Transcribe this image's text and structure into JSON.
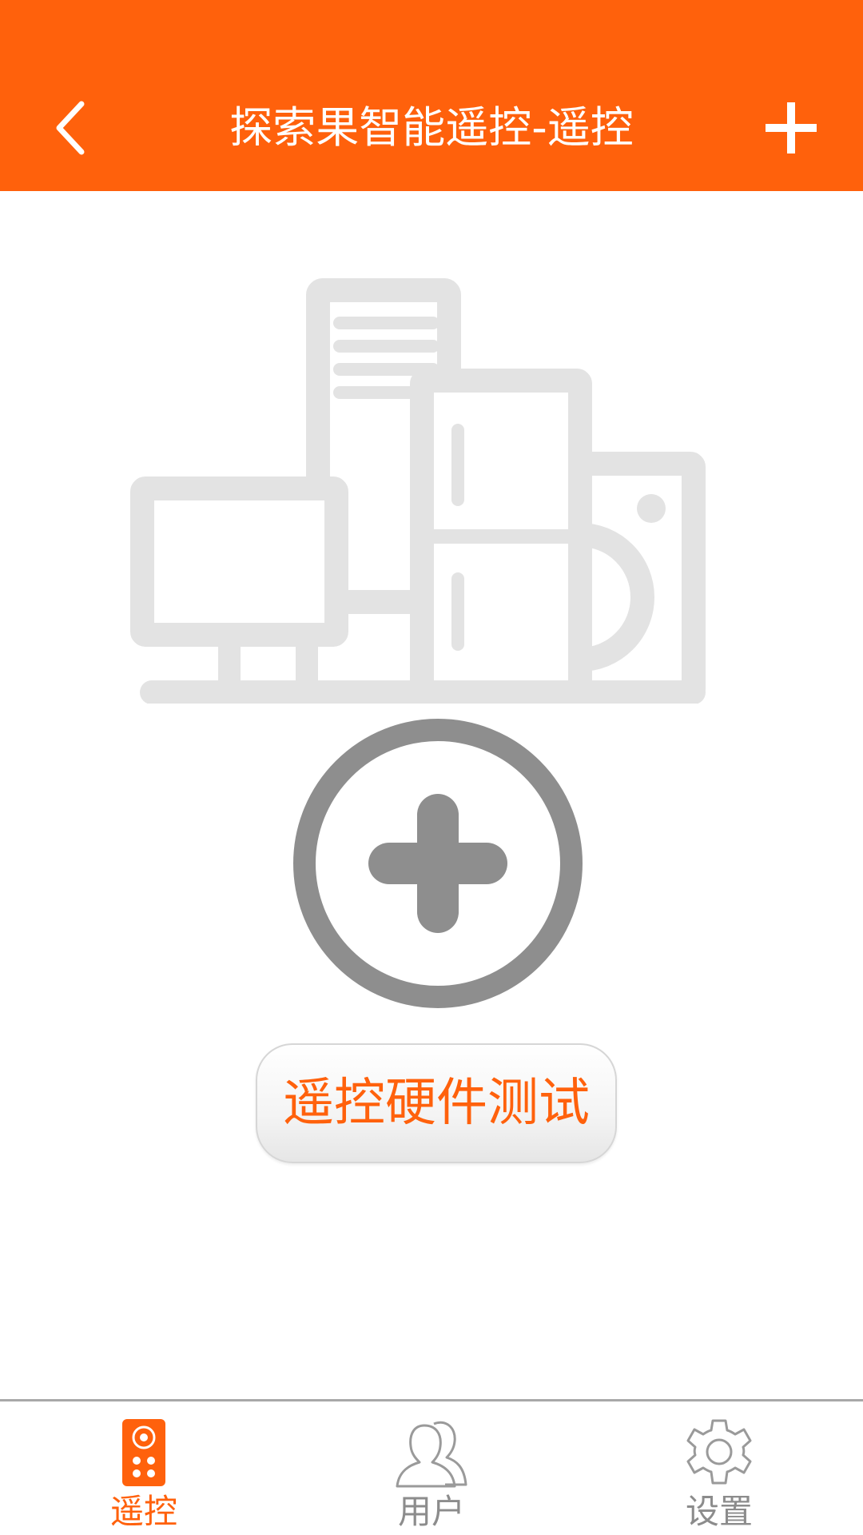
{
  "header": {
    "title": "探索果智能遥控-遥控",
    "back_icon": "chevron-left-icon",
    "add_icon": "plus-icon",
    "background_color": "#ff610c"
  },
  "main": {
    "illustration_icon": "appliances-illustration",
    "add_icon": "circle-plus-icon",
    "test_button_label": "遥控硬件测试"
  },
  "tabbar": {
    "active_color": "#ff610c",
    "inactive_color": "#8c8c8c",
    "tabs": [
      {
        "label": "遥控",
        "icon": "remote-control-icon",
        "active": true
      },
      {
        "label": "用户",
        "icon": "users-icon",
        "active": false
      },
      {
        "label": "设置",
        "icon": "gear-icon",
        "active": false
      }
    ]
  }
}
